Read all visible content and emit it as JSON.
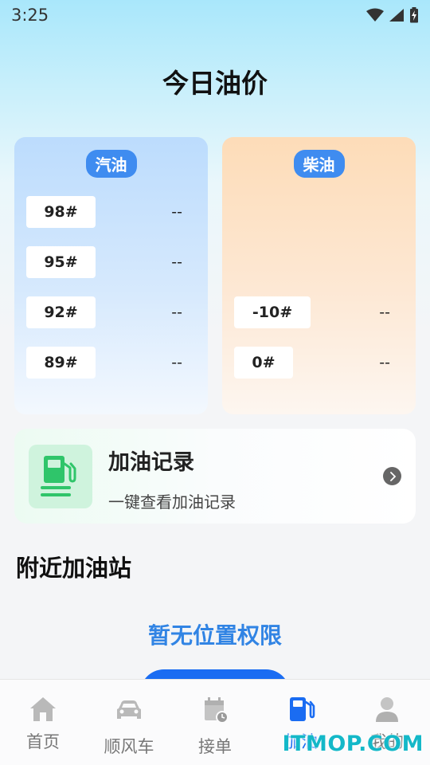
{
  "status_bar": {
    "time": "3:25",
    "icons": [
      "wifi-icon",
      "signal-icon",
      "battery-charging-icon"
    ]
  },
  "page_title": "今日油价",
  "gasoline": {
    "label": "汽油",
    "grades": [
      {
        "grade": "98#",
        "price": "--"
      },
      {
        "grade": "95#",
        "price": "--"
      },
      {
        "grade": "92#",
        "price": "--"
      },
      {
        "grade": "89#",
        "price": "--"
      }
    ]
  },
  "diesel": {
    "label": "柴油",
    "grades": [
      {
        "grade": "-10#",
        "price": "--"
      },
      {
        "grade": "0#",
        "price": "--"
      }
    ]
  },
  "refuel_record": {
    "title": "加油记录",
    "subtitle": "一键查看加油记录",
    "icon": "fuel-pump-icon",
    "arrow_icon": "chevron-right-icon"
  },
  "nearby_section_title": "附近加油站",
  "no_permission_text": "暂无位置权限",
  "bottom_nav": [
    {
      "label": "首页",
      "icon": "home-icon"
    },
    {
      "label": "顺风车",
      "icon": "car-icon"
    },
    {
      "label": "接单",
      "icon": "calendar-clock-icon"
    },
    {
      "label": "加油",
      "icon": "fuel-icon",
      "active": true
    },
    {
      "label": "我的",
      "icon": "person-icon"
    }
  ],
  "watermark": "ITMOP.COM",
  "colors": {
    "accent": "#1a6cf2",
    "pill_blue": "#3f8cf0",
    "link_blue": "#3184e4",
    "green_icon": "#2fc56a"
  }
}
